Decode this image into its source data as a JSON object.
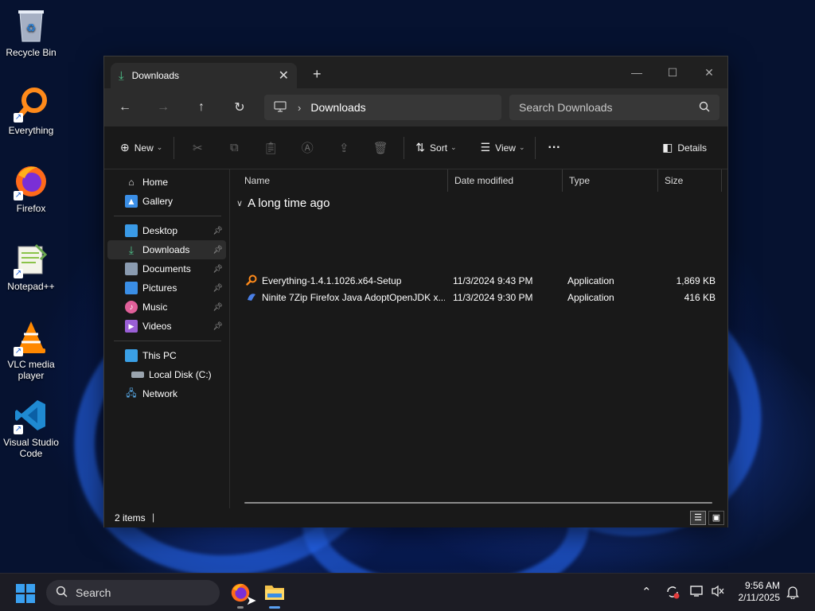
{
  "desktop": {
    "icons": [
      {
        "label": "Recycle Bin",
        "icon": "recycle-bin-icon"
      },
      {
        "label": "Everything",
        "icon": "everything-icon"
      },
      {
        "label": "Firefox",
        "icon": "firefox-icon"
      },
      {
        "label": "Notepad++",
        "icon": "notepadpp-icon"
      },
      {
        "label": "VLC media player",
        "icon": "vlc-icon"
      },
      {
        "label": "Visual Studio Code",
        "icon": "vscode-icon"
      }
    ]
  },
  "window": {
    "tab_title": "Downloads",
    "tab_close": "✕",
    "new_tab": "+",
    "controls": {
      "minimize": "—",
      "maximize": "☐",
      "close": "✕"
    },
    "nav": {
      "back": "←",
      "forward": "→",
      "up": "↑",
      "refresh": "↻"
    },
    "address": {
      "separator": "›",
      "crumb": "Downloads"
    },
    "search_placeholder": "Search Downloads",
    "commands": {
      "new": "New",
      "sort": "Sort",
      "view": "View",
      "more": "···",
      "details": "Details"
    },
    "sidebar": {
      "top": [
        {
          "label": "Home",
          "icon": "home-icon"
        },
        {
          "label": "Gallery",
          "icon": "gallery-icon"
        }
      ],
      "quick_access": [
        {
          "label": "Desktop",
          "icon": "desktop-folder-icon",
          "pinned": true
        },
        {
          "label": "Downloads",
          "icon": "downloads-folder-icon",
          "pinned": true,
          "selected": true
        },
        {
          "label": "Documents",
          "icon": "documents-folder-icon",
          "pinned": true
        },
        {
          "label": "Pictures",
          "icon": "pictures-folder-icon",
          "pinned": true
        },
        {
          "label": "Music",
          "icon": "music-folder-icon",
          "pinned": true
        },
        {
          "label": "Videos",
          "icon": "videos-folder-icon",
          "pinned": true
        }
      ],
      "devices": [
        {
          "label": "This PC",
          "icon": "this-pc-icon"
        },
        {
          "label": "Local Disk (C:)",
          "icon": "local-disk-icon"
        },
        {
          "label": "Network",
          "icon": "network-icon"
        }
      ]
    },
    "columns": [
      "Name",
      "Date modified",
      "Type",
      "Size"
    ],
    "group_label": "A long time ago",
    "files": [
      {
        "name": "Everything-1.4.1.1026.x64-Setup",
        "date": "11/3/2024 9:43 PM",
        "type": "Application",
        "size": "1,869 KB",
        "icon": "everything-icon"
      },
      {
        "name": "Ninite 7Zip Firefox Java AdoptOpenJDK x...",
        "date": "11/3/2024 9:30 PM",
        "type": "Application",
        "size": "416 KB",
        "icon": "ninite-icon"
      }
    ],
    "status": {
      "item_count": "2 items",
      "caret": "|"
    }
  },
  "taskbar": {
    "search_label": "Search",
    "clock_time": "9:56 AM",
    "clock_date": "2/11/2025"
  }
}
